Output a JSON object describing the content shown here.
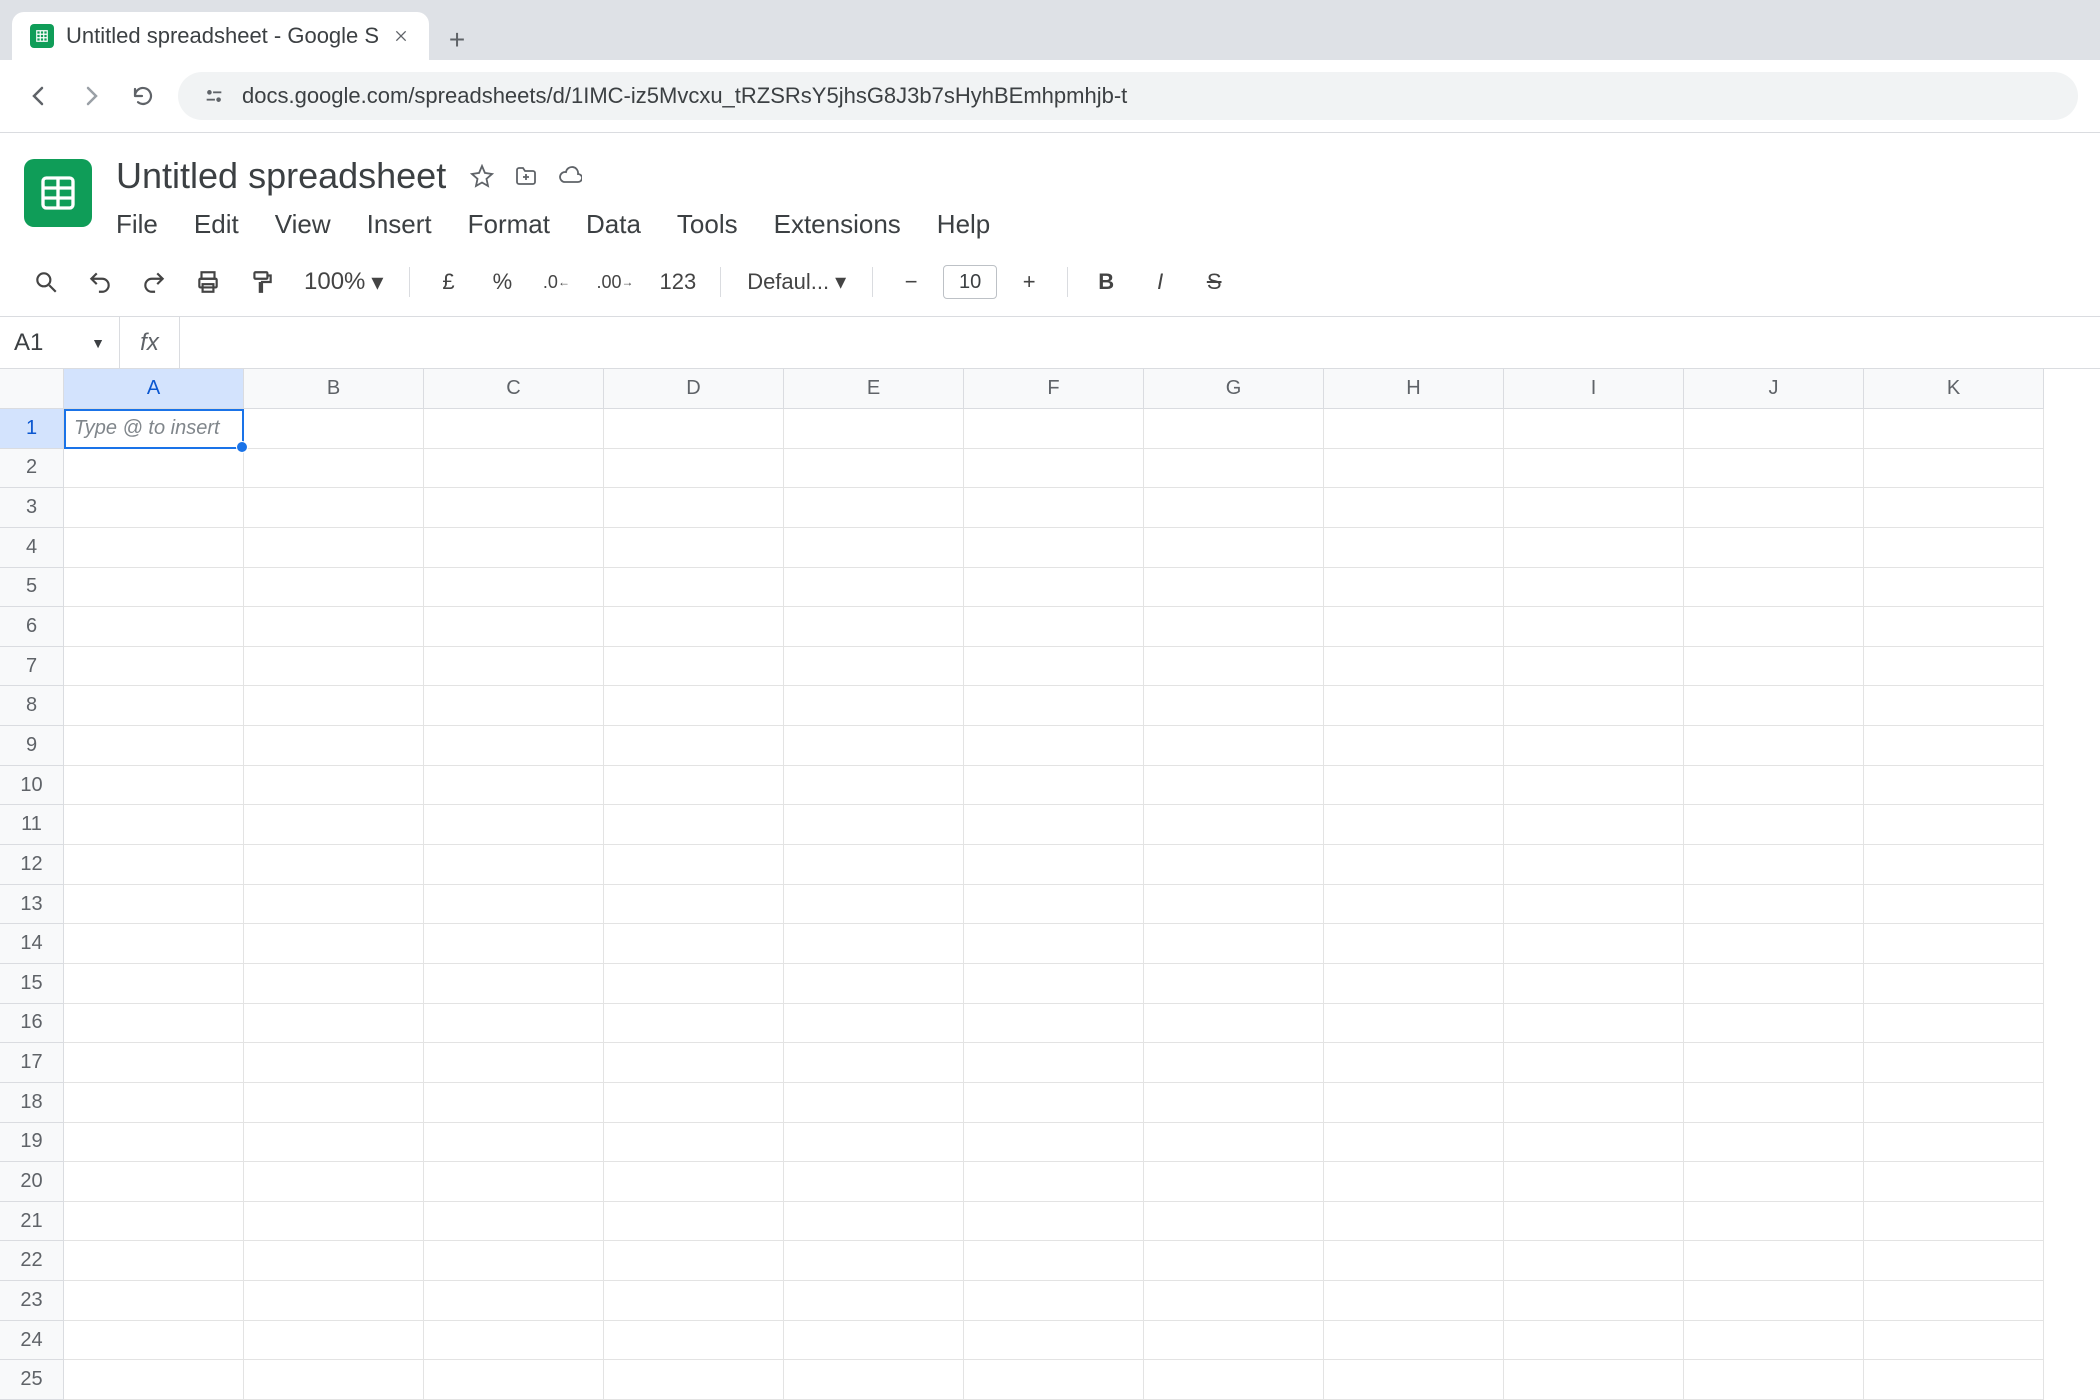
{
  "browser": {
    "tab": {
      "title": "Untitled spreadsheet - Google S",
      "favicon": "sheets"
    },
    "url": "docs.google.com/spreadsheets/d/1IMC-iz5Mvcxu_tRZSRsY5jhsG8J3b7sHyhBEmhpmhjb-t"
  },
  "header": {
    "doc_title": "Untitled spreadsheet",
    "menus": [
      "File",
      "Edit",
      "View",
      "Insert",
      "Format",
      "Data",
      "Tools",
      "Extensions",
      "Help"
    ]
  },
  "toolbar": {
    "zoom": "100%",
    "currency": "£",
    "percent": "%",
    "dec_decrease": ".0",
    "dec_increase": ".00",
    "num_format": "123",
    "font": "Defaul...",
    "font_size": "10"
  },
  "namebox": {
    "ref": "A1"
  },
  "formula": {
    "fx": "fx",
    "value": ""
  },
  "grid": {
    "columns": [
      "A",
      "B",
      "C",
      "D",
      "E",
      "F",
      "G",
      "H",
      "I",
      "J",
      "K"
    ],
    "rows": [
      "1",
      "2",
      "3",
      "4",
      "5",
      "6",
      "7",
      "8",
      "9",
      "10",
      "11",
      "12",
      "13",
      "14",
      "15",
      "16",
      "17",
      "18",
      "19",
      "20",
      "21",
      "22",
      "23",
      "24",
      "25"
    ],
    "active_cell": "A1",
    "active_placeholder": "Type @ to insert"
  }
}
